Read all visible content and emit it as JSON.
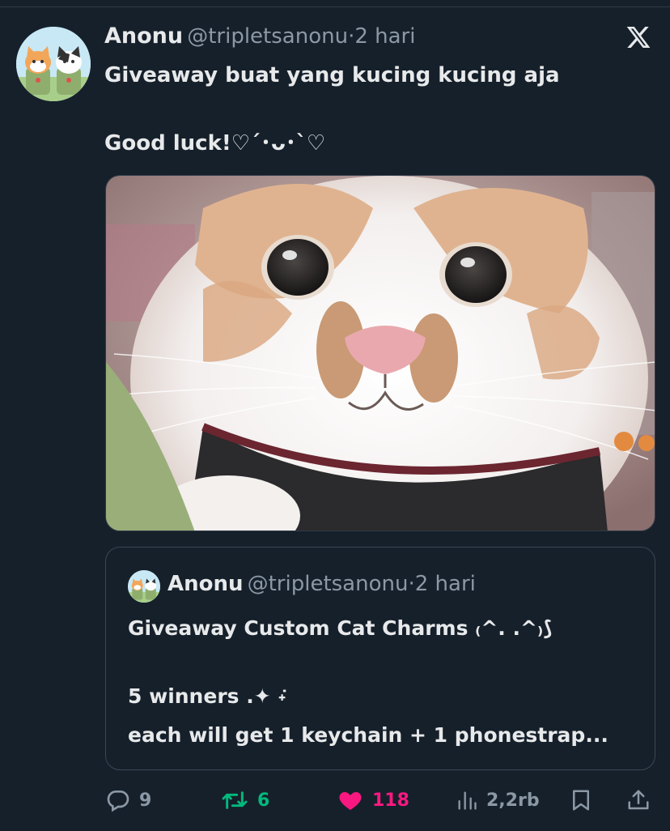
{
  "tweet": {
    "author_name": "Anonu",
    "handle": "@tripletsanonu",
    "separator": "·",
    "time": "2 hari",
    "text_line1": "Giveaway buat yang kucing kucing aja",
    "text_line2": "Good luck!♡´･ᴗ･`♡",
    "platform_icon": "x-logo-icon",
    "avatar_icon": "avatar-two-cats"
  },
  "media": {
    "description_icon": "cat-photo"
  },
  "quote": {
    "author_name": "Anonu",
    "handle": "@tripletsanonu",
    "separator": "·",
    "time": "2 hari",
    "text_line1": "Giveaway Custom Cat Charms ₍^. .^₎⟆",
    "text_line2": "5 winners .✦ ݁˖",
    "text_line3": "each will get 1 keychain + 1 phonestrap..."
  },
  "actions": {
    "replies": "9",
    "reposts": "6",
    "likes": "118",
    "views": "2,2rb"
  },
  "colors": {
    "background": "#16202b",
    "text": "#e7e9ea",
    "secondary": "#8b98a5",
    "repost_active": "#00ba7c",
    "like_active": "#f91880"
  }
}
